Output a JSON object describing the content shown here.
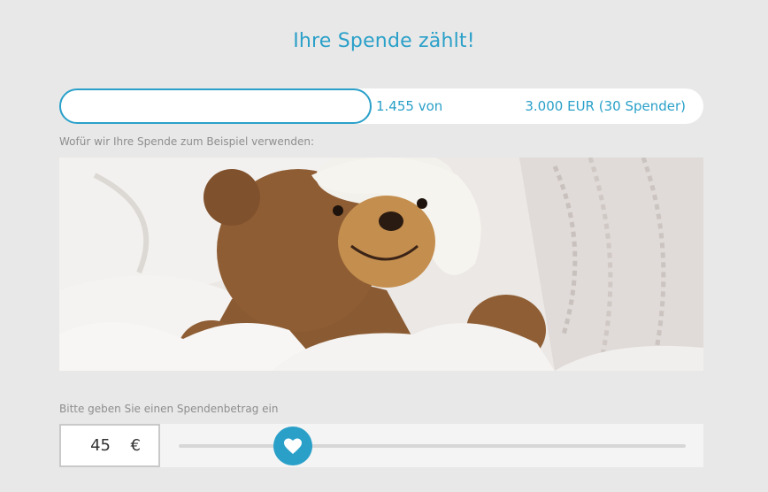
{
  "header": {
    "title": "Ihre Spende zählt!"
  },
  "progress": {
    "raised_text": "1.455 von",
    "goal_text": "3.000 EUR (30 Spender)",
    "fraction": 0.485
  },
  "example": {
    "caption": "Wofür wir Ihre Spende zum Beispiel verwenden:"
  },
  "donation": {
    "label": "Bitte geben Sie einen Spendenbetrag ein",
    "amount": "45",
    "currency": "€",
    "slider_fraction": 0.226
  },
  "colors": {
    "accent": "#2aa0c9",
    "background": "#e8e8e8",
    "label": "#8e8e8e"
  },
  "icons": {
    "slider_thumb": "heart-icon"
  }
}
